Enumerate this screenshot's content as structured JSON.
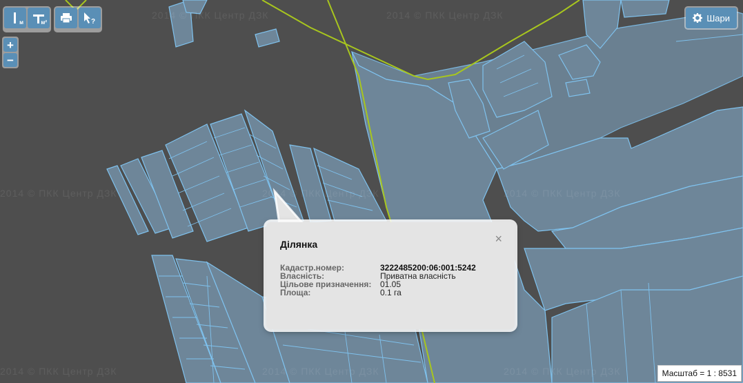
{
  "toolbar": {
    "measure_length_sub": "м",
    "measure_area_sub": "м²"
  },
  "layers_button": {
    "label": "Шари"
  },
  "zoom": {
    "in": "+",
    "out": "−"
  },
  "watermark": "2014 © ПКК  Центр ДЗК",
  "popup": {
    "title": "Ділянка",
    "close": "×",
    "rows": [
      {
        "label": "Кадастр.номер:",
        "value": "3222485200:06:001:5242"
      },
      {
        "label": "Власність:",
        "value": "Приватна власність"
      },
      {
        "label": "Цільове призначення:",
        "value": "01.05"
      },
      {
        "label": "Площа:",
        "value": "0.1 га"
      }
    ]
  },
  "scale": {
    "text": "Масштаб = 1 : 8531"
  },
  "colors": {
    "background": "#4e4e4e",
    "parcel_fill": "#6e8699",
    "parcel_stroke": "#7fc2ee",
    "boundary_line": "#a8c61e",
    "button": "#5a8fb6"
  }
}
